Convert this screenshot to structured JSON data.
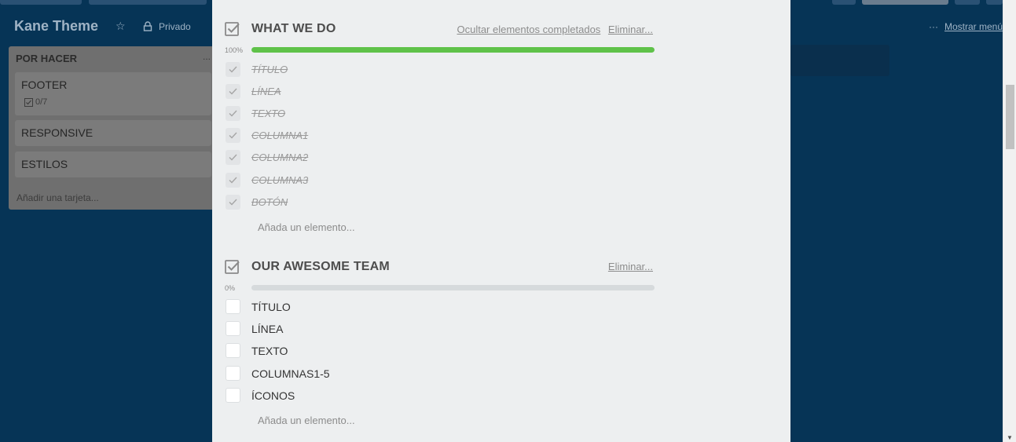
{
  "board": {
    "title": "Kane Theme",
    "privacy": "Privado",
    "show_menu": "Mostrar menú"
  },
  "list": {
    "title": "POR HACER",
    "menu": "...",
    "cards": [
      {
        "title": "FOOTER",
        "badge": "0/7"
      },
      {
        "title": "RESPONSIVE"
      },
      {
        "title": "ESTILOS"
      }
    ],
    "add_card": "Añadir una tarjeta..."
  },
  "checklists": [
    {
      "title": "WHAT WE DO",
      "hide_completed": "Ocultar elementos completados",
      "delete": "Eliminar...",
      "percent_label": "100%",
      "progress": 1.0,
      "items": [
        {
          "label": "TÍTULO",
          "done": true
        },
        {
          "label": "LÍNEA",
          "done": true
        },
        {
          "label": "TEXTO",
          "done": true
        },
        {
          "label": "COLUMNA1",
          "done": true
        },
        {
          "label": "COLUMNA2",
          "done": true
        },
        {
          "label": "COLUMNA3",
          "done": true
        },
        {
          "label": "BOTÓN",
          "done": true
        }
      ],
      "add_item": "Añada un elemento..."
    },
    {
      "title": "OUR AWESOME TEAM",
      "delete": "Eliminar...",
      "percent_label": "0%",
      "progress": 0.0,
      "items": [
        {
          "label": "TÍTULO",
          "done": false
        },
        {
          "label": "LÍNEA",
          "done": false
        },
        {
          "label": "TEXTO",
          "done": false
        },
        {
          "label": "COLUMNAS1-5",
          "done": false
        },
        {
          "label": "ÍCONOS",
          "done": false
        }
      ],
      "add_item": "Añada un elemento..."
    }
  ],
  "colors": {
    "progress_complete": "#5fc249",
    "progress_track": "#d6dadc",
    "board_bg": "#063456",
    "modal_bg": "#edeff0"
  }
}
